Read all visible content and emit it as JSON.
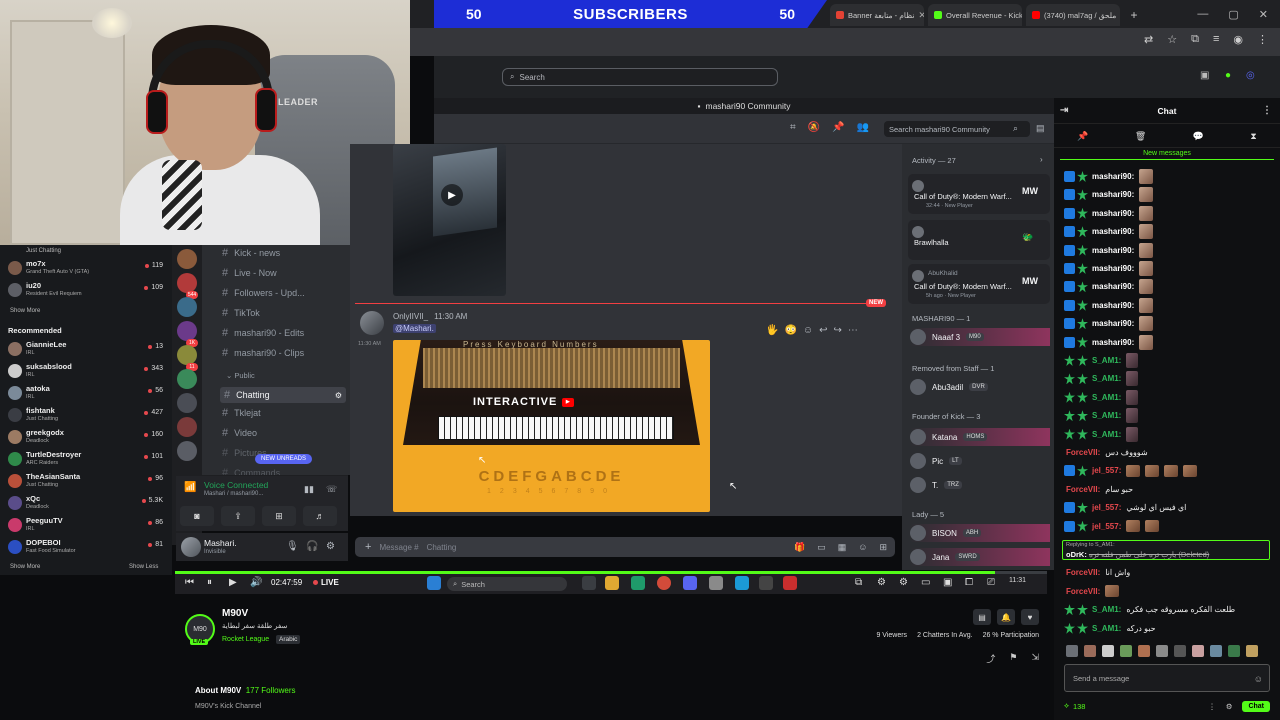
{
  "overlay": {
    "subs_left": "50",
    "subs_title": "SUBSCRIBERS",
    "subs_right": "50",
    "webcam_brand": "LEADER"
  },
  "browser": {
    "tabs": [
      {
        "label": "Banner نظام - متابعة",
        "color": "#e34234"
      },
      {
        "label": "Overall Revenue - Kick D",
        "color": "#53fc18"
      },
      {
        "label": "(3740) mal7ag / ملحق",
        "color": "#ff0000"
      }
    ],
    "new_tab": "+",
    "win_min": "—",
    "win_max": "▢",
    "win_close": "✕"
  },
  "discord": {
    "search_placeholder": "Search",
    "window_title": "mashari90 Community",
    "header_search": "Search mashari90 Community",
    "channels": [
      {
        "name": "Kick - news"
      },
      {
        "name": "Live - Now"
      },
      {
        "name": "Followers - Upd..."
      },
      {
        "name": "TikTok"
      },
      {
        "name": "mashari90 - Edits"
      },
      {
        "name": "mashari90 - Clips"
      }
    ],
    "public_label": "Public",
    "active_channel": "Chatting",
    "more_channels": [
      {
        "name": "Tklejat"
      },
      {
        "name": "Video"
      },
      {
        "name": "Pictures"
      },
      {
        "name": "Commands"
      }
    ],
    "new_unreads": "NEW UNREADS",
    "voice_connected": "Voice Connected",
    "voice_sub": "Mashari / mashari90...",
    "user_name": "Mashari.",
    "user_status": "Invisible",
    "message_author": "OnlyIIVII_",
    "message_time": "11:30 AM",
    "message_mention": "@Mashari.",
    "message_time_left": "11:30 AM",
    "new_tag": "NEW",
    "piano_top": "Press Keyboard Numbers",
    "piano_label": "INTERACTIVE",
    "piano_notes": "CDEFGABCDE",
    "piano_nums": "1234567890",
    "composer_placeholder": "Message #",
    "composer_channel": "Chatting",
    "activity_header": "Activity — 27",
    "activity": [
      {
        "name": "Call of Duty®: Modern Warf...",
        "sub": "32:44",
        "tag": "New Player",
        "glyph": "MW"
      },
      {
        "name": "Brawlhalla",
        "sub": "",
        "tag": "",
        "glyph": "🐲"
      },
      {
        "name": "Call of Duty®: Modern Warf...",
        "sub": "5h ago",
        "tag": "New Player",
        "glyph": "MW",
        "user": "AbuKhalid"
      }
    ],
    "sections": [
      {
        "label": "MASHARI90 — 1"
      },
      {
        "label": "Removed from Staff — 1"
      },
      {
        "label": "Founder of Kick — 3"
      },
      {
        "label": "Lady — 5"
      }
    ],
    "members": [
      {
        "name": "Naaaf 3",
        "tag": "M90"
      },
      {
        "name": "Abu3adil",
        "tag": "DVR"
      },
      {
        "name": "Katana",
        "tag": "HOMS"
      },
      {
        "name": "Pic",
        "tag": "LT"
      },
      {
        "name": "T.",
        "tag": "TRZ"
      },
      {
        "name": "BISON",
        "tag": "ABH"
      },
      {
        "name": "Jana",
        "tag": "SWRD"
      }
    ]
  },
  "kick_sidebar": {
    "top_sub": "Just Chatting",
    "following": [
      {
        "name": "mo7x",
        "sub": "Grand Theft Auto V (GTA)",
        "viewers": "119"
      },
      {
        "name": "iu20",
        "sub": "Resident Evil Requiem",
        "viewers": "109"
      }
    ],
    "show_more": "Show More",
    "recommended_title": "Recommended",
    "recommended": [
      {
        "name": "GiannieLee",
        "sub": "IRL",
        "viewers": "13"
      },
      {
        "name": "suksabslood",
        "sub": "IRL",
        "viewers": "343"
      },
      {
        "name": "aatoka",
        "sub": "IRL",
        "viewers": "56"
      },
      {
        "name": "fishtank",
        "sub": "Just Chatting",
        "viewers": "427"
      },
      {
        "name": "greekgodx",
        "sub": "Deadlock",
        "viewers": "160"
      },
      {
        "name": "TurtleDestroyer",
        "sub": "ARC Raiders",
        "viewers": "101"
      },
      {
        "name": "TheAsianSanta",
        "sub": "Just Chatting",
        "viewers": "96"
      },
      {
        "name": "xQc",
        "sub": "Deadlock",
        "viewers": "5.3K"
      },
      {
        "name": "PeeguuTV",
        "sub": "IRL",
        "viewers": "86"
      },
      {
        "name": "DOPEBOI",
        "sub": "Fast Food Simulator",
        "viewers": "81"
      }
    ],
    "show_more2": "Show More",
    "show_less": "Show Less"
  },
  "player": {
    "elapsed": "02:47:59",
    "live": "LIVE",
    "search": "Search",
    "clock": "11:31",
    "progress": 0.94
  },
  "channel": {
    "name": "M90V",
    "title": "سفر طلقة سفر لبطاية",
    "category": "Rocket League",
    "language": "Arabic",
    "avatar_text": "M90",
    "live_badge": "LIVE",
    "viewers": "9 Viewers",
    "chatters": "2 Chatters In Avg.",
    "participation": "26 % Participation",
    "about_title": "About M90V",
    "followers": "177 Followers",
    "about_sub": "M90V's Kick Channel"
  },
  "chat": {
    "title": "Chat",
    "new_messages": "New messages",
    "lines": [
      {
        "user": "mashari90:",
        "color": "#ffffff",
        "badges": [
          "blue",
          "green"
        ],
        "emote": "face"
      },
      {
        "user": "mashari90:",
        "color": "#ffffff",
        "badges": [
          "blue",
          "green"
        ],
        "emote": "face"
      },
      {
        "user": "mashari90:",
        "color": "#ffffff",
        "badges": [
          "blue",
          "green"
        ],
        "emote": "face"
      },
      {
        "user": "mashari90:",
        "color": "#ffffff",
        "badges": [
          "blue",
          "green"
        ],
        "emote": "face"
      },
      {
        "user": "mashari90:",
        "color": "#ffffff",
        "badges": [
          "blue",
          "green"
        ],
        "emote": "face"
      },
      {
        "user": "mashari90:",
        "color": "#ffffff",
        "badges": [
          "blue",
          "green"
        ],
        "emote": "face"
      },
      {
        "user": "mashari90:",
        "color": "#ffffff",
        "badges": [
          "blue",
          "green"
        ],
        "emote": "face"
      },
      {
        "user": "mashari90:",
        "color": "#ffffff",
        "badges": [
          "blue",
          "green"
        ],
        "emote": "face"
      },
      {
        "user": "mashari90:",
        "color": "#ffffff",
        "badges": [
          "blue",
          "green"
        ],
        "emote": "face"
      },
      {
        "user": "mashari90:",
        "color": "#ffffff",
        "badges": [
          "blue",
          "green"
        ],
        "emote": "face"
      },
      {
        "user": "S_AM1:",
        "color": "#2fb85c",
        "badges": [
          "green",
          "green"
        ],
        "emote": "dark"
      },
      {
        "user": "S_AM1:",
        "color": "#2fb85c",
        "badges": [
          "green",
          "green"
        ],
        "emote": "dark"
      },
      {
        "user": "S_AM1:",
        "color": "#2fb85c",
        "badges": [
          "green",
          "green"
        ],
        "emote": "dark"
      },
      {
        "user": "S_AM1:",
        "color": "#2fb85c",
        "badges": [
          "green",
          "green"
        ],
        "emote": "dark"
      },
      {
        "user": "S_AM1:",
        "color": "#2fb85c",
        "badges": [
          "green",
          "green"
        ],
        "emote": "dark"
      },
      {
        "user": "ForceVII:",
        "color": "#e5484d",
        "badges": [],
        "text": "شوووف دس"
      },
      {
        "user": "jel_557:",
        "color": "#e5484d",
        "badges": [
          "blue",
          "green"
        ],
        "emote": "row"
      },
      {
        "user": "ForceVII:",
        "color": "#e5484d",
        "badges": [],
        "text": "حبو سام"
      },
      {
        "user": "jel_557:",
        "color": "#e5484d",
        "badges": [
          "blue",
          "green"
        ],
        "text": "اي فيس اي لوشي"
      },
      {
        "user": "jel_557:",
        "color": "#e5484d",
        "badges": [
          "blue",
          "green"
        ],
        "emote": "row2"
      }
    ],
    "reply_to": "Replying to S_AM1:",
    "reply_user": "oDrK:",
    "reply_text": "يارب تره على طمن فلته تره (Deleted)",
    "lines2": [
      {
        "user": "ForceVII:",
        "color": "#e5484d",
        "badges": [],
        "text": "واش انا"
      },
      {
        "user": "ForceVII:",
        "color": "#e5484d",
        "badges": [],
        "emote": "one"
      },
      {
        "user": "S_AM1:",
        "color": "#2fb85c",
        "badges": [
          "green",
          "green"
        ],
        "text": "طلعت الفكره مسروقه جب فكره"
      },
      {
        "user": "S_AM1:",
        "color": "#2fb85c",
        "badges": [
          "green",
          "green"
        ],
        "text": "حبو دركه"
      }
    ],
    "input_placeholder": "Send a message",
    "points": "138",
    "send_label": "Chat"
  }
}
